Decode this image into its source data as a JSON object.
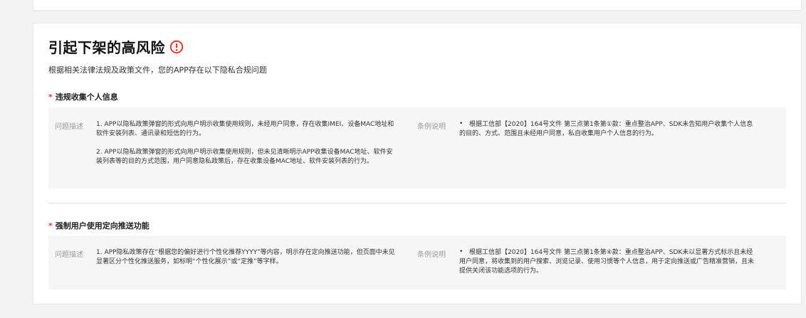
{
  "header": {
    "title": "引起下架的高风险",
    "subtitle": "根据相关法律法规及政策文件，您的APP存在以下隐私合规问题"
  },
  "sections": [
    {
      "star": "*",
      "title": "违规收集个人信息",
      "problem_label": "问题描述",
      "rule_label": "条例说明",
      "problems": [
        "1. APP以隐私政策弹窗的形式向用户明示收集使用规则，未经用户同意，存在收集IMEI、设备MAC地址和软件安装列表、通讯录和短信的行为。",
        "2. APP以隐私政策弹窗的形式向用户明示收集使用规则，但未见清晰明示APP收集设备MAC地址、软件安装列表等的目的方式范围，用户同意隐私政策后，存在收集设备MAC地址、软件安装列表的行为。"
      ],
      "rule": "根据工信部【2020】164号文件 第三点第1条第①款：重点整治APP、SDK未告知用户收集个人信息的目的、方式、范围且未经用户同意，私自收集用户个人信息的行为。"
    },
    {
      "star": "*",
      "title": "强制用户使用定向推送功能",
      "problem_label": "问题描述",
      "rule_label": "条例说明",
      "problems": [
        "1. APP隐私政策存在“根据您的偏好进行个性化推荐YYYY”等内容，明示存在定向推送功能，但页面中未见显著区分个性化推送服务，如标明“个性化展示”或“定推”等字样。"
      ],
      "rule": "根据工信部【2020】164号文件 第三点第1条第④款：重点整治APP、SDK未以显著方式标示且未经用户同意，将收集到的用户搜索、浏览记录、使用习惯等个人信息，用于定向推送或广告精准营销，且未提供关闭该功能选项的行为。"
    }
  ],
  "bullet_char": "•",
  "colors": {
    "star": "#e53935",
    "warning_icon": "#e53935"
  },
  "icons": {
    "warning": "exclamation-circle-icon"
  }
}
